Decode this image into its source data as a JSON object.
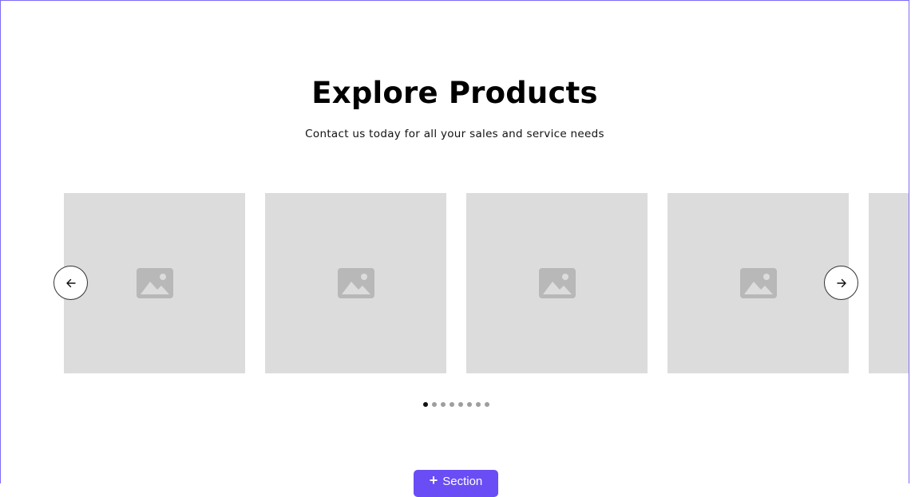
{
  "header": {
    "title": "Explore Products",
    "subtitle": "Contact us today for all your sales and service needs"
  },
  "carousel": {
    "cards": [
      {
        "icon": "image-placeholder-icon"
      },
      {
        "icon": "image-placeholder-icon"
      },
      {
        "icon": "image-placeholder-icon"
      },
      {
        "icon": "image-placeholder-icon"
      },
      {
        "icon": "image-placeholder-icon"
      }
    ],
    "prev_icon": "arrow-left-icon",
    "next_icon": "arrow-right-icon",
    "dots_count": 8,
    "active_dot": 0
  },
  "add_section": {
    "label": "Section",
    "icon": "plus-icon"
  },
  "colors": {
    "accent": "#6a4df5",
    "frame_border": "#7b6cf6",
    "placeholder_bg": "#dcdcdc",
    "placeholder_icon": "#b8b8b8"
  }
}
